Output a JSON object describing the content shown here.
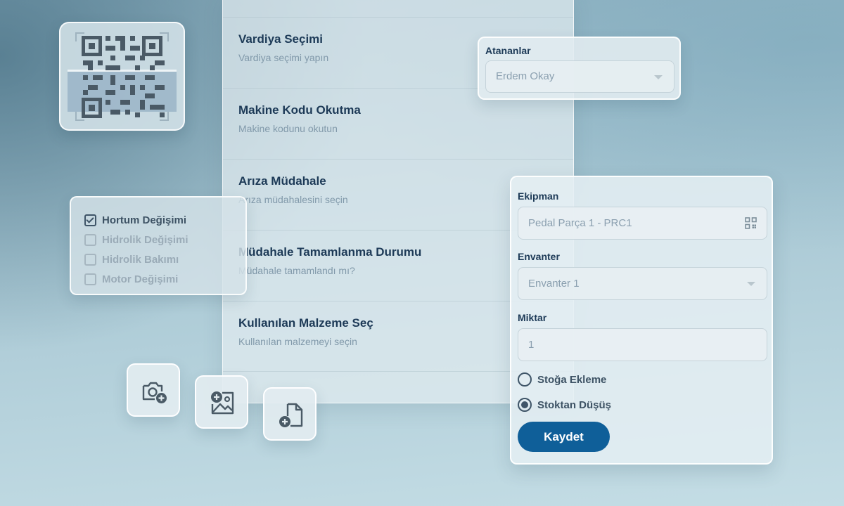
{
  "colors": {
    "primary": "#0f5f99",
    "heading": "#1d3a57",
    "muted": "#8199aa"
  },
  "tasks": [
    {
      "title": "Vardiya Seçimi",
      "subtitle": "Vardiya seçimi yapın"
    },
    {
      "title": "Makine Kodu Okutma",
      "subtitle": "Makine kodunu okutun"
    },
    {
      "title": "Arıza Müdahale",
      "subtitle": "Arıza müdahalesini seçin"
    },
    {
      "title": "Müdahale Tamamlanma Durumu",
      "subtitle": "Müdahale tamamlandı mı?"
    },
    {
      "title": "Kullanılan Malzeme Seç",
      "subtitle": "Kullanılan malzemeyi seçin"
    }
  ],
  "assignees": {
    "label": "Atananlar",
    "selected": "Erdem Okay"
  },
  "checklist": [
    {
      "label": "Hortum Değişimi",
      "checked": true
    },
    {
      "label": "Hidrolik Değişimi",
      "checked": false
    },
    {
      "label": "Hidrolik Bakımı",
      "checked": false
    },
    {
      "label": "Motor Değişimi",
      "checked": false
    }
  ],
  "attachments": {
    "camera_icon": "camera-plus-icon",
    "image_icon": "image-plus-icon",
    "file_icon": "file-plus-icon"
  },
  "form": {
    "equipment_label": "Ekipman",
    "equipment_value": "Pedal Parça 1 - PRC1",
    "inventory_label": "Envanter",
    "inventory_value": "Envanter 1",
    "quantity_label": "Miktar",
    "quantity_value": "1",
    "radio_add": "Stoğa Ekleme",
    "radio_deduct": "Stoktan Düşüş",
    "selected_radio": "deduct",
    "save_label": "Kaydet"
  }
}
